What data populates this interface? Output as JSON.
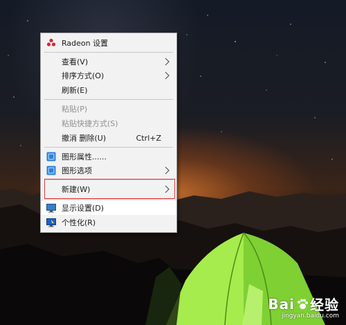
{
  "context_menu": {
    "header": {
      "label": "Radeon 设置",
      "icon": "radeon-logo-icon"
    },
    "items": [
      {
        "label": "查看(V)",
        "submenu": true
      },
      {
        "label": "排序方式(O)",
        "submenu": true
      },
      {
        "label": "刷新(E)"
      },
      {
        "label": "粘贴(P)",
        "disabled": true
      },
      {
        "label": "粘贴快捷方式(S)",
        "disabled": true
      },
      {
        "label": "撤消 删除(U)",
        "shortcut": "Ctrl+Z"
      },
      {
        "label": "图形属性......",
        "icon": "intel-graphics-icon"
      },
      {
        "label": "图形选项",
        "icon": "intel-graphics-icon",
        "submenu": true
      },
      {
        "label": "新建(W)",
        "submenu": true
      },
      {
        "label": "显示设置(D)",
        "icon": "display-icon"
      },
      {
        "label": "个性化(R)",
        "icon": "personalize-icon"
      }
    ]
  },
  "watermark": {
    "brand_left": "Bai",
    "brand_right": "经验",
    "url": "jingyan.baidu.com"
  },
  "colors": {
    "menu_bg": "#f2f2f2",
    "highlight_box": "#e04040",
    "tent_green": "#8fe03a"
  }
}
